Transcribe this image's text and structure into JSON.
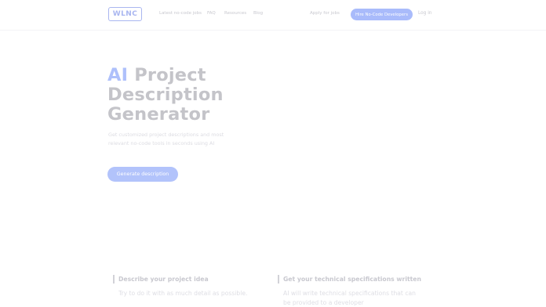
{
  "header": {
    "logo": "WLNC",
    "nav": {
      "latest_jobs": "Latest no-code jobs",
      "faq": "FAQ",
      "resources": "Resources",
      "blog": "Blog"
    },
    "apply": "Apply for jobs",
    "hire": "Hire No-Code Developers",
    "login": "Log in"
  },
  "hero": {
    "title_accent": "AI",
    "title_rest_1": "Project",
    "title_line_2": "Description",
    "title_line_3": "Generator",
    "subtitle": "Get customized project descriptions and most relevant no-code tools in seconds using AI",
    "button": "Generate description"
  },
  "steps": [
    {
      "title": "Describe your project idea",
      "text": "Try to do it with as much detail as possible."
    },
    {
      "title": "Get your technical specifications written",
      "text": "AI will write technical specifications that can be provided to a developer"
    }
  ],
  "colors": {
    "accent": "#a9bbfb",
    "title": "#c4c4c9"
  }
}
